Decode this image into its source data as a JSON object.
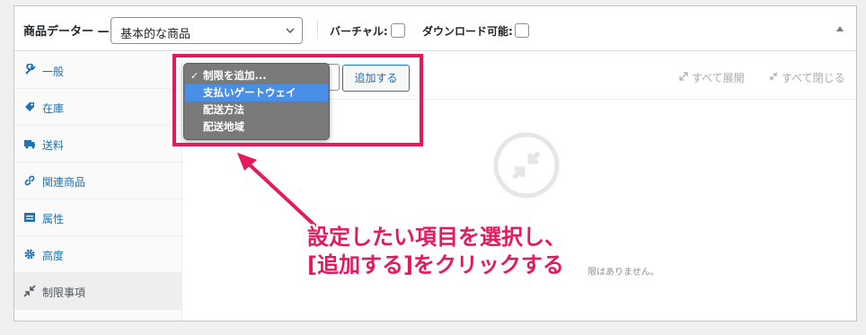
{
  "header": {
    "title": "商品データー —",
    "product_type": "基本的な商品",
    "virtual_label": "バーチャル:",
    "downloadable_label": "ダウンロード可能:"
  },
  "sidebar": {
    "items": [
      {
        "label": "一般",
        "icon": "wrench-icon"
      },
      {
        "label": "在庫",
        "icon": "tag-icon"
      },
      {
        "label": "送料",
        "icon": "truck-icon"
      },
      {
        "label": "関連商品",
        "icon": "link-icon"
      },
      {
        "label": "属性",
        "icon": "list-icon"
      },
      {
        "label": "高度",
        "icon": "gear-icon"
      },
      {
        "label": "制限事項",
        "icon": "shrink-icon",
        "active": true
      }
    ]
  },
  "toolbar": {
    "add_button": "追加する",
    "expand_all": "すべて展開",
    "collapse_all": "すべて閉じる"
  },
  "dropdown": {
    "items": [
      "制限を追加...",
      "支払いゲートウェイ",
      "配送方法",
      "配送地域"
    ],
    "selected_index": 0,
    "highlighted_index": 1,
    "check": "✓"
  },
  "empty_state": {
    "text": "限はありません。"
  },
  "annotation": {
    "line1": "設定したい項目を選択し、",
    "line2": "[追加する]をクリックする",
    "color": "#e5195e"
  }
}
